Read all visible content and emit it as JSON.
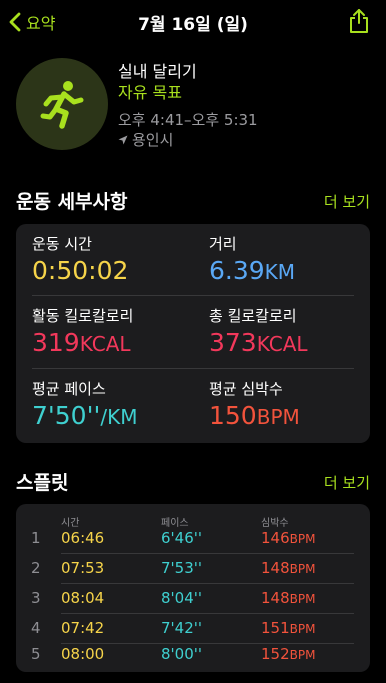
{
  "colors": {
    "accent": "#a8e01e",
    "time": "#f6d44a",
    "distance": "#5aa8f5",
    "calorie": "#f2385b",
    "pace": "#3fd0d0",
    "heart": "#f2533c",
    "card": "#1c1c1e"
  },
  "nav": {
    "back_label": "요약",
    "title": "7월 16일 (일)"
  },
  "workout": {
    "icon": "running-figure-icon",
    "title": "실내 달리기",
    "goal": "자유 목표",
    "time_range": "오후 4:41–오후 5:31",
    "location": "용인시"
  },
  "details": {
    "title": "운동 세부사항",
    "more": "더 보기",
    "duration": {
      "label": "운동 시간",
      "value": "0:50:02"
    },
    "distance": {
      "label": "거리",
      "value": "6.39",
      "unit": "KM"
    },
    "active_cal": {
      "label": "활동 킬로칼로리",
      "value": "319",
      "unit": "KCAL"
    },
    "total_cal": {
      "label": "총 킬로칼로리",
      "value": "373",
      "unit": "KCAL"
    },
    "avg_pace": {
      "label": "평균 페이스",
      "value": "7'50''",
      "unit": "/KM"
    },
    "avg_hr": {
      "label": "평균 심박수",
      "value": "150",
      "unit": "BPM"
    }
  },
  "splits": {
    "title": "스플릿",
    "more": "더 보기",
    "headers": {
      "time": "시간",
      "pace": "페이스",
      "heart": "심박수"
    },
    "unit_bpm": "BPM",
    "rows": [
      {
        "index": "1",
        "time": "06:46",
        "pace": "6'46''",
        "heart": "146"
      },
      {
        "index": "2",
        "time": "07:53",
        "pace": "7'53''",
        "heart": "148"
      },
      {
        "index": "3",
        "time": "08:04",
        "pace": "8'04''",
        "heart": "148"
      },
      {
        "index": "4",
        "time": "07:42",
        "pace": "7'42''",
        "heart": "151"
      },
      {
        "index": "5",
        "time": "08:00",
        "pace": "8'00''",
        "heart": "152"
      }
    ]
  }
}
